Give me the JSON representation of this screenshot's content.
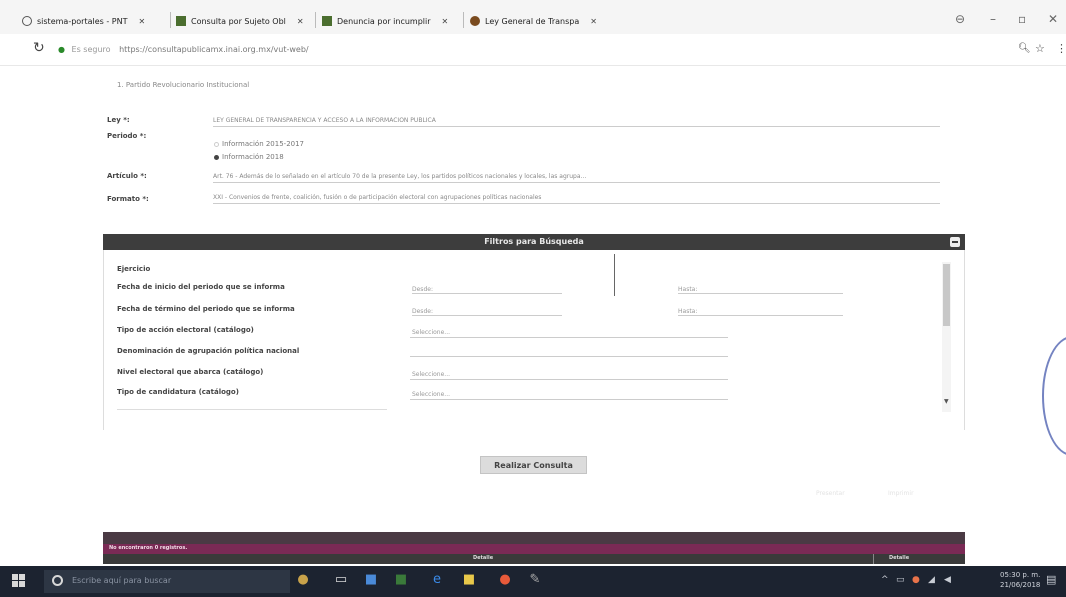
{
  "browser": {
    "tabs": [
      {
        "label": "sistema-portales - PNT"
      },
      {
        "label": "Consulta por Sujeto Obl"
      },
      {
        "label": "Denuncia por incumplir"
      },
      {
        "label": "Ley General de Transpa"
      }
    ],
    "url_secure_label": "Es seguro",
    "url": "https://consultapublicamx.inai.org.mx/vut-web/"
  },
  "page": {
    "breadcrumb": "1. Partido Revolucionario Institucional",
    "ley_label": "Ley *:",
    "ley_value": "LEY GENERAL DE TRANSPARENCIA Y ACCESO A LA INFORMACIÓN PÚBLICA",
    "periodo_label": "Periodo *:",
    "periodo_options": [
      "Información 2015-2017",
      "Información 2018"
    ],
    "articulo_label": "Artículo *:",
    "articulo_value": "Art. 76 - Además de lo señalado en el artículo 70 de la presente Ley, los partidos políticos nacionales y locales, las agrupa...",
    "formato_label": "Formato *:",
    "formato_value": "XXI - Convenios de frente, coalición, fusión o de participación electoral con agrupaciones políticas nacionales"
  },
  "filters": {
    "title": "Filtros para Búsqueda",
    "desde": "Desde:",
    "hasta": "Hasta:",
    "seleccione": "Seleccione...",
    "items": [
      "Ejercicio",
      "Fecha de inicio del periodo que se informa",
      "Fecha de término del periodo que se informa",
      "Tipo de acción electoral (catálogo)",
      "Denominación de agrupación política nacional",
      "Nivel electoral que abarca (catálogo)",
      "Tipo de candidatura (catálogo)"
    ]
  },
  "actions": {
    "realizar": "Realizar Consulta",
    "faded_left": "Presentar",
    "faded_right": "Imprimir"
  },
  "results": {
    "count_text": "No encontraron 0 registros.",
    "col1": "Detalle",
    "col2": "Detalle"
  },
  "taskbar": {
    "search_placeholder": "Escribe aquí para buscar",
    "time": "05:30 p. m.",
    "date": "21/06/2018"
  },
  "colors": {
    "header_dark": "#3d3d3d",
    "results_band": "#7a2a55",
    "taskbar": "#1c2330"
  }
}
